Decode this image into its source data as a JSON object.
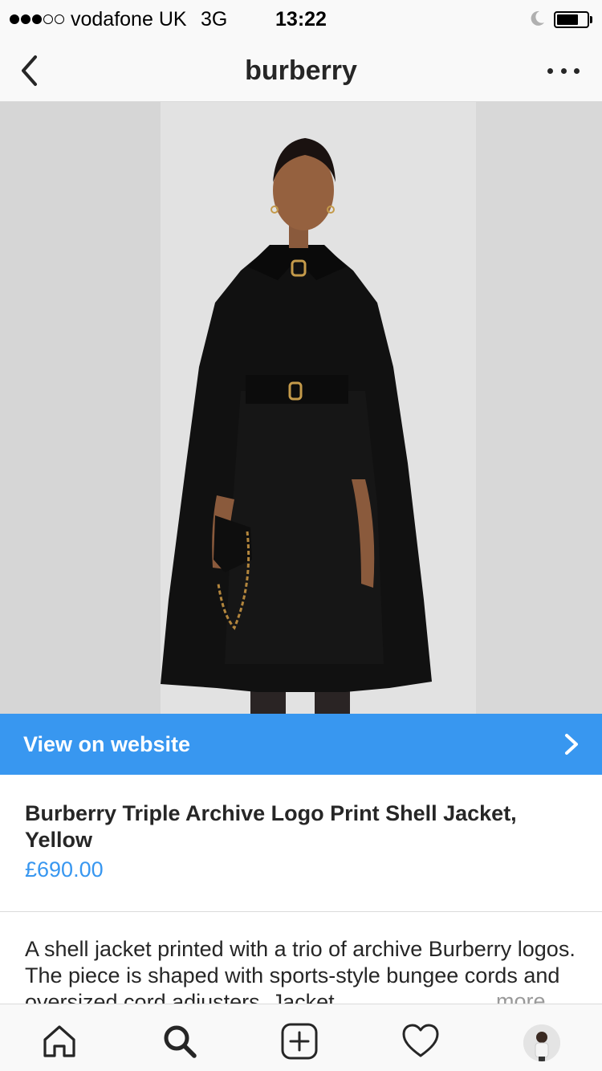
{
  "status_bar": {
    "carrier": "vodafone UK",
    "network": "3G",
    "time": "13:22",
    "signal_bars_filled": 3,
    "signal_bars_total": 5,
    "battery_level": 0.72,
    "icons": [
      "signal-dots-icon",
      "moon-icon",
      "battery-icon"
    ]
  },
  "header": {
    "title": "burberry",
    "back_icon": "chevron-left-icon",
    "more_icon": "ellipsis-icon"
  },
  "product": {
    "image_description_icon": "product-photo",
    "cta_label": "View on website",
    "cta_icon": "chevron-right-icon",
    "name": "Burberry Triple Archive Logo Print Shell Jacket, Yellow",
    "price": "£690.00",
    "description": "A shell jacket printed with a trio of archive Burberry logos. The piece is shaped with sports-style bungee cords and oversized cord adjusters. Jacket",
    "more_label": "more"
  },
  "tab_bar": {
    "tabs": [
      {
        "name": "home",
        "icon": "home-icon"
      },
      {
        "name": "search",
        "icon": "search-icon"
      },
      {
        "name": "add",
        "icon": "add-post-icon"
      },
      {
        "name": "activity",
        "icon": "heart-icon"
      },
      {
        "name": "profile",
        "icon": "avatar"
      }
    ]
  },
  "colors": {
    "accent_blue": "#3897f0",
    "text": "#262626",
    "muted": "#999999",
    "bar_bg": "#f9f9f9",
    "divider": "#dbdbdb"
  }
}
